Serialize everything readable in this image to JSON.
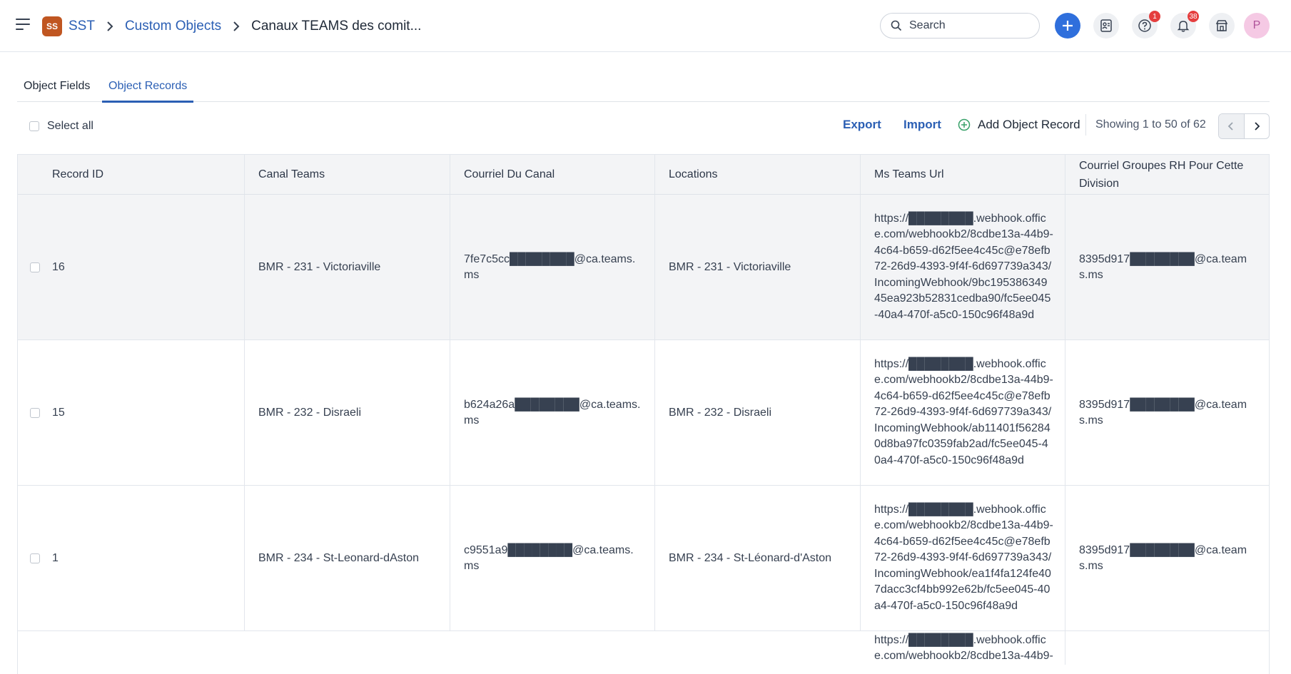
{
  "header": {
    "workspace_badge": "SS",
    "breadcrumbs": [
      "SST",
      "Custom Objects",
      "Canaux TEAMS des comit..."
    ],
    "search_placeholder": "Search",
    "help_badge": "1",
    "notifications_badge": "38",
    "avatar_letter": "P"
  },
  "tabs": [
    {
      "label": "Object Fields",
      "active": false
    },
    {
      "label": "Object Records",
      "active": true
    }
  ],
  "toolbar": {
    "select_all": "Select all",
    "export": "Export",
    "import": "Import",
    "add_record": "Add Object Record",
    "showing": "Showing 1 to 50 of 62"
  },
  "table": {
    "columns": [
      "Record ID",
      "Canal Teams",
      "Courriel Du Canal",
      "Locations",
      "Ms Teams Url",
      "Courriel Groupes RH Pour Cette Division"
    ],
    "rows": [
      {
        "record_id": "16",
        "canal": "BMR - 231 - Victoriaville",
        "courriel": "7fe7c5cc████████@ca.teams.ms",
        "location": "BMR - 231 - Victoriaville",
        "url": "https://████████.webhook.office.com/webhookb2/8cdbe13a-44b9-4c64-b659-d62f5ee4c45c@e78efb72-26d9-4393-9f4f-6d697739a343/IncomingWebhook/9bc19538634945ea923b52831cedba90/fc5ee045-40a4-470f-a5c0-150c96f48a9d",
        "rh": "8395d917████████@ca.teams.ms"
      },
      {
        "record_id": "15",
        "canal": "BMR - 232 - Disraeli",
        "courriel": "b624a26a████████@ca.teams.ms",
        "location": "BMR - 232 - Disraeli",
        "url": "https://████████.webhook.office.com/webhookb2/8cdbe13a-44b9-4c64-b659-d62f5ee4c45c@e78efb72-26d9-4393-9f4f-6d697739a343/IncomingWebhook/ab11401f562840d8ba97fc0359fab2ad/fc5ee045-40a4-470f-a5c0-150c96f48a9d",
        "rh": "8395d917████████@ca.teams.ms"
      },
      {
        "record_id": "1",
        "canal": "BMR - 234 - St-Leonard-dAston",
        "courriel": "c9551a9████████@ca.teams.ms",
        "location": "BMR - 234 - St-Léonard-d'Aston",
        "url": "https://████████.webhook.office.com/webhookb2/8cdbe13a-44b9-4c64-b659-d62f5ee4c45c@e78efb72-26d9-4393-9f4f-6d697739a343/IncomingWebhook/ea1f4fa124fe407dacc3cf4bb992e62b/fc5ee045-40a4-470f-a5c0-150c96f48a9d",
        "rh": "8395d917████████@ca.teams.ms"
      },
      {
        "record_id": "",
        "canal": "",
        "courriel": "",
        "location": "",
        "url": "https://████████.webhook.office.com/webhookb2/8cdbe13a-44b9-",
        "rh": ""
      }
    ]
  },
  "colors": {
    "accent": "#2b5fb4",
    "primary_button": "#2f6fdc",
    "badge_red": "#e53e3e",
    "workspace_badge": "#c05621",
    "row_highlight": "#f3f4f6"
  }
}
